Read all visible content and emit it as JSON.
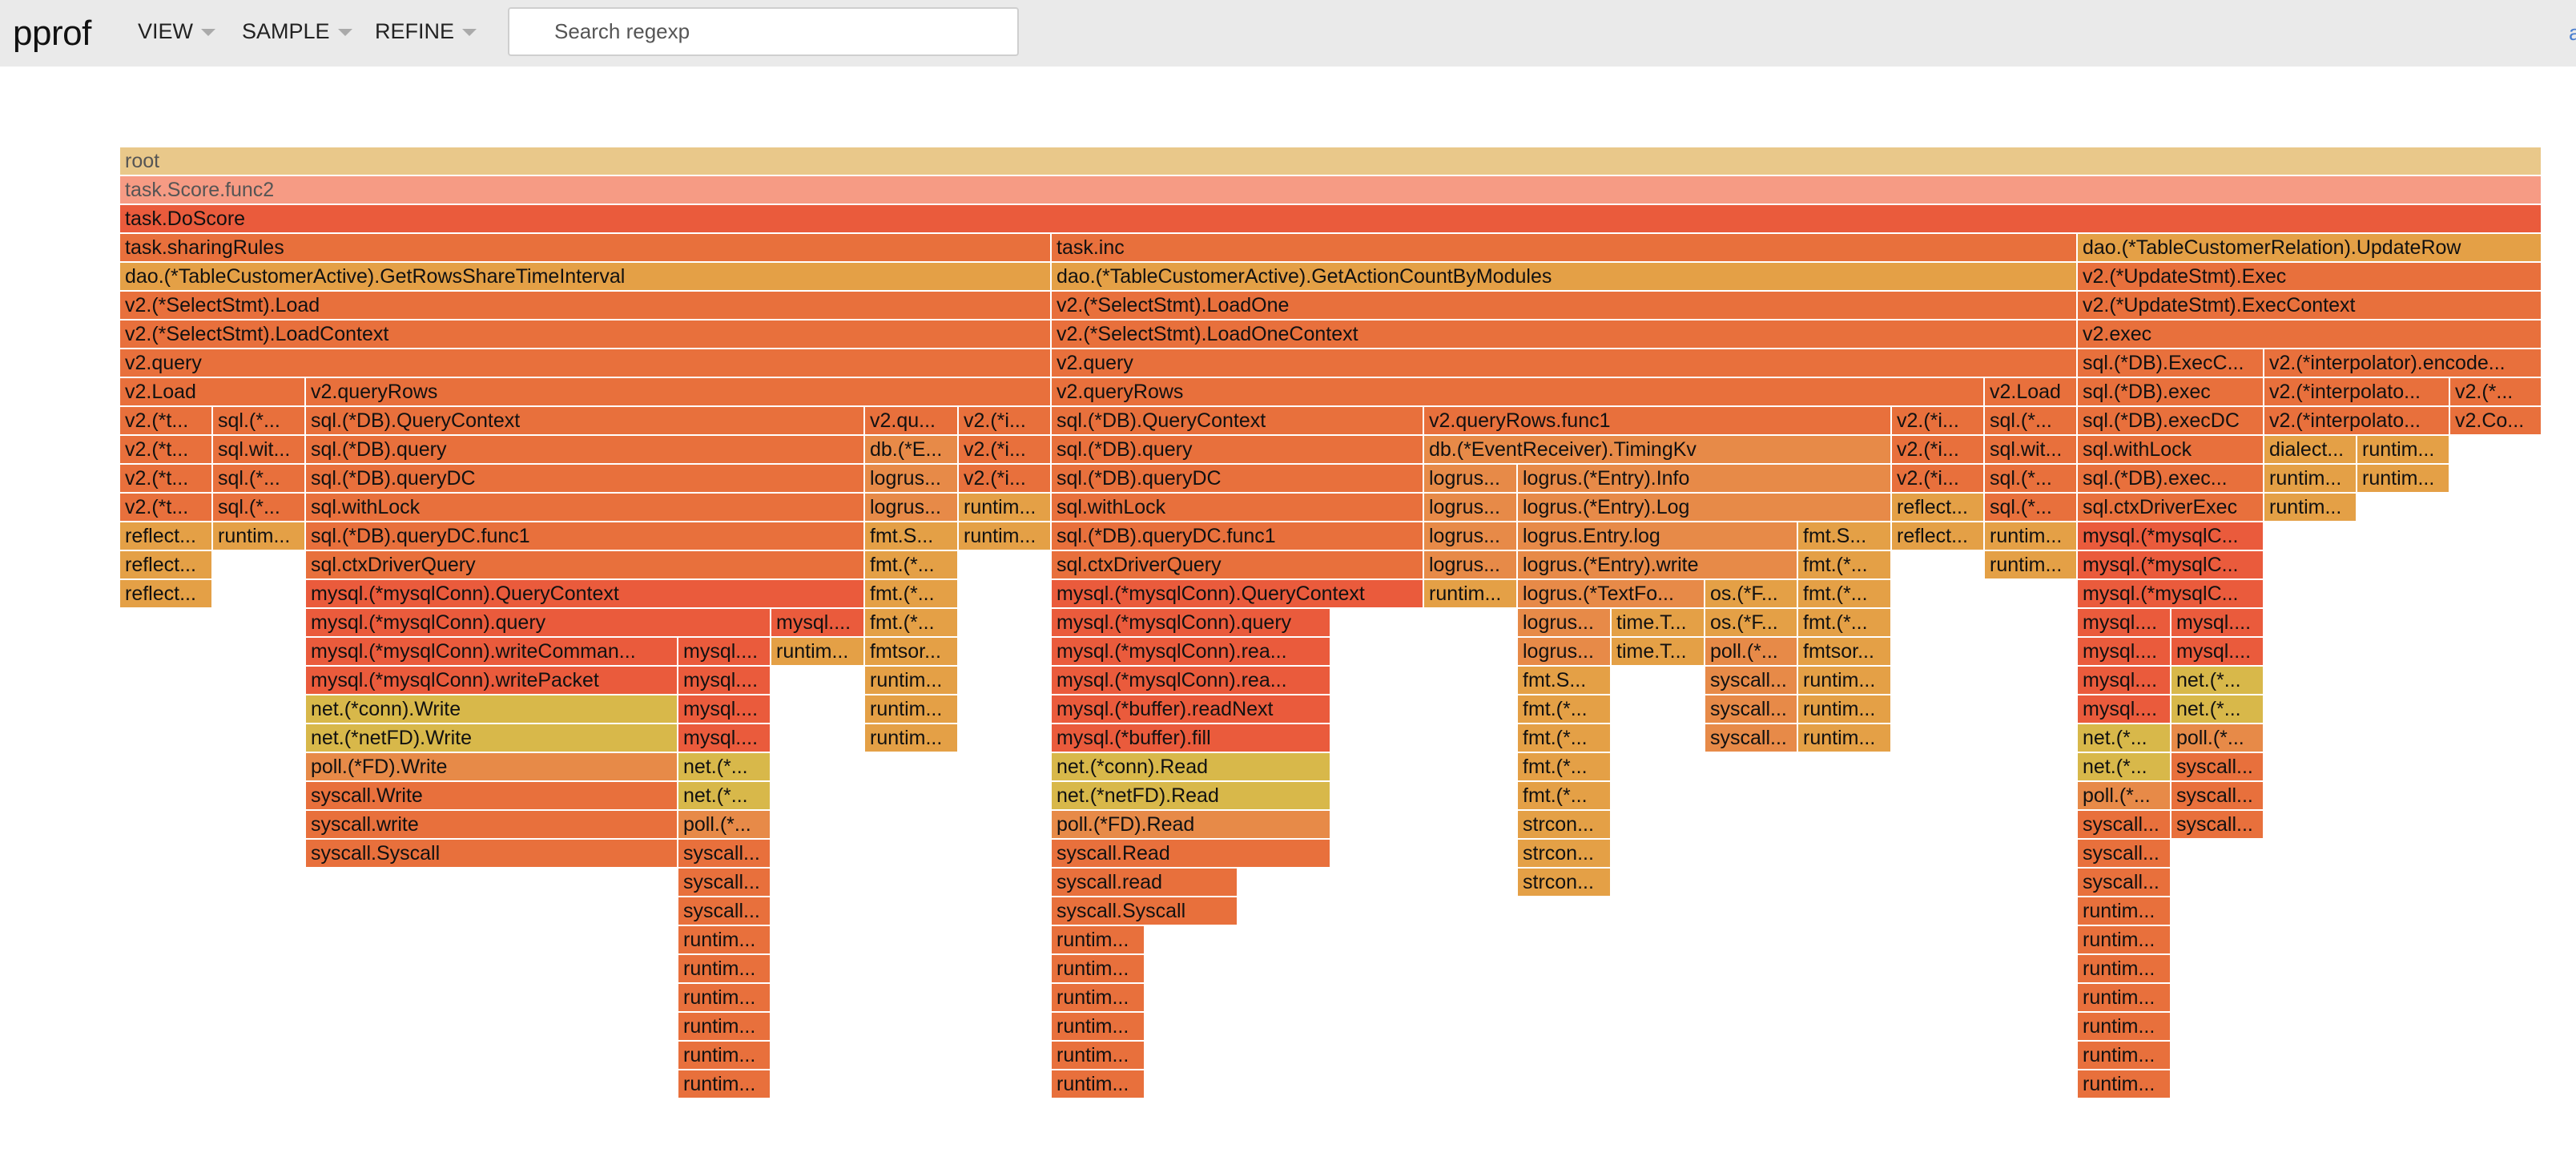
{
  "app": {
    "logo": "pprof",
    "menus": [
      {
        "label": "VIEW"
      },
      {
        "label": "SAMPLE"
      },
      {
        "label": "REFINE"
      }
    ],
    "search_placeholder": "Search regexp",
    "corner_link": "a"
  },
  "colors": {
    "root": "#e9c88a",
    "pink": "#f69b84",
    "red": "#ea5b3c",
    "orange": "#e8703c",
    "amber": "#e4a046",
    "yellow": "#d8b84a",
    "coral": "#e78a48"
  },
  "frames": [
    [
      "root",
      "root"
    ],
    [
      "task.Score.func2",
      "pink"
    ],
    [
      "task.DoScore",
      "red"
    ],
    [
      "task.sharingRules",
      "orange"
    ],
    [
      "task.inc",
      "orange"
    ],
    [
      "dao.(*TableCustomerRelation).UpdateRow",
      "amber"
    ],
    [
      "dao.(*TableCustomerActive).GetRowsShareTimeInterval",
      "amber"
    ],
    [
      "dao.(*TableCustomerActive).GetActionCountByModules",
      "amber"
    ],
    [
      "v2.(*UpdateStmt).Exec",
      "orange"
    ],
    [
      "v2.(*SelectStmt).Load",
      "orange"
    ],
    [
      "v2.(*SelectStmt).LoadOne",
      "orange"
    ],
    [
      "v2.(*UpdateStmt).ExecContext",
      "orange"
    ],
    [
      "v2.(*SelectStmt).LoadContext",
      "orange"
    ],
    [
      "v2.(*SelectStmt).LoadOneContext",
      "orange"
    ],
    [
      "v2.exec",
      "orange"
    ],
    [
      "v2.query",
      "orange"
    ],
    [
      "v2.query",
      "orange"
    ],
    [
      "sql.(*DB).ExecC...",
      "orange"
    ],
    [
      "v2.(*interpolator).encode...",
      "orange"
    ],
    [
      "v2.Load",
      "orange"
    ],
    [
      "v2.queryRows",
      "orange"
    ],
    [
      "v2.queryRows",
      "orange"
    ],
    [
      "v2.Load",
      "orange"
    ],
    [
      "sql.(*DB).exec",
      "orange"
    ],
    [
      "v2.(*interpolato...",
      "orange"
    ],
    [
      "v2.(*...",
      "orange"
    ],
    [
      "v2.(*t...",
      "orange"
    ],
    [
      "sql.(*...",
      "orange"
    ],
    [
      "sql.(*DB).QueryContext",
      "orange"
    ],
    [
      "v2.qu...",
      "orange"
    ],
    [
      "v2.(*i...",
      "orange"
    ],
    [
      "sql.(*DB).QueryContext",
      "orange"
    ],
    [
      "v2.queryRows.func1",
      "orange"
    ],
    [
      "v2.(*i...",
      "orange"
    ],
    [
      "sql.(*...",
      "orange"
    ],
    [
      "sql.(*DB).execDC",
      "orange"
    ],
    [
      "v2.(*interpolato...",
      "orange"
    ],
    [
      "v2.Co...",
      "orange"
    ],
    [
      "v2.(*t...",
      "orange"
    ],
    [
      "sql.wit...",
      "orange"
    ],
    [
      "sql.(*DB).query",
      "orange"
    ],
    [
      "db.(*E...",
      "coral"
    ],
    [
      "v2.(*i...",
      "orange"
    ],
    [
      "sql.(*DB).query",
      "orange"
    ],
    [
      "db.(*EventReceiver).TimingKv",
      "coral"
    ],
    [
      "v2.(*i...",
      "orange"
    ],
    [
      "sql.wit...",
      "orange"
    ],
    [
      "sql.withLock",
      "orange"
    ],
    [
      "dialect...",
      "amber"
    ],
    [
      "runtim...",
      "amber"
    ],
    [
      "v2.(*t...",
      "orange"
    ],
    [
      "sql.(*...",
      "orange"
    ],
    [
      "sql.(*DB).queryDC",
      "orange"
    ],
    [
      "logrus...",
      "coral"
    ],
    [
      "v2.(*i...",
      "orange"
    ],
    [
      "sql.(*DB).queryDC",
      "orange"
    ],
    [
      "logrus...",
      "coral"
    ],
    [
      "logrus.(*Entry).Info",
      "coral"
    ],
    [
      "v2.(*i...",
      "orange"
    ],
    [
      "sql.(*...",
      "orange"
    ],
    [
      "sql.(*DB).exec...",
      "orange"
    ],
    [
      "runtim...",
      "amber"
    ],
    [
      "runtim...",
      "amber"
    ],
    [
      "v2.(*t...",
      "orange"
    ],
    [
      "sql.(*...",
      "orange"
    ],
    [
      "sql.withLock",
      "orange"
    ],
    [
      "logrus...",
      "coral"
    ],
    [
      "runtim...",
      "amber"
    ],
    [
      "sql.withLock",
      "orange"
    ],
    [
      "logrus...",
      "coral"
    ],
    [
      "logrus.(*Entry).Log",
      "coral"
    ],
    [
      "reflect...",
      "amber"
    ],
    [
      "sql.(*...",
      "orange"
    ],
    [
      "sql.ctxDriverExec",
      "orange"
    ],
    [
      "runtim...",
      "amber"
    ],
    [
      "reflect...",
      "amber"
    ],
    [
      "runtim...",
      "amber"
    ],
    [
      "sql.(*DB).queryDC.func1",
      "orange"
    ],
    [
      "fmt.S...",
      "amber"
    ],
    [
      "runtim...",
      "amber"
    ],
    [
      "sql.(*DB).queryDC.func1",
      "orange"
    ],
    [
      "logrus...",
      "coral"
    ],
    [
      "logrus.Entry.log",
      "coral"
    ],
    [
      "fmt.S...",
      "amber"
    ],
    [
      "reflect...",
      "amber"
    ],
    [
      "runtim...",
      "amber"
    ],
    [
      "mysql.(*mysqlC...",
      "red"
    ],
    [
      "reflect...",
      "amber"
    ],
    [
      "sql.ctxDriverQuery",
      "orange"
    ],
    [
      "fmt.(*...",
      "amber"
    ],
    [
      "sql.ctxDriverQuery",
      "orange"
    ],
    [
      "logrus...",
      "coral"
    ],
    [
      "logrus.(*Entry).write",
      "coral"
    ],
    [
      "fmt.(*...",
      "amber"
    ],
    [
      "runtim...",
      "amber"
    ],
    [
      "mysql.(*mysqlC...",
      "red"
    ],
    [
      "reflect...",
      "amber"
    ],
    [
      "mysql.(*mysqlConn).QueryContext",
      "red"
    ],
    [
      "fmt.(*...",
      "amber"
    ],
    [
      "mysql.(*mysqlConn).QueryContext",
      "red"
    ],
    [
      "runtim...",
      "amber"
    ],
    [
      "logrus.(*TextFo...",
      "coral"
    ],
    [
      "os.(*F...",
      "amber"
    ],
    [
      "fmt.(*...",
      "amber"
    ],
    [
      "mysql.(*mysqlC...",
      "red"
    ],
    [
      "mysql.(*mysqlConn).query",
      "red"
    ],
    [
      "mysql....",
      "red"
    ],
    [
      "fmt.(*...",
      "amber"
    ],
    [
      "mysql.(*mysqlConn).query",
      "red"
    ],
    [
      "logrus...",
      "coral"
    ],
    [
      "time.T...",
      "amber"
    ],
    [
      "os.(*F...",
      "amber"
    ],
    [
      "fmt.(*...",
      "amber"
    ],
    [
      "mysql....",
      "red"
    ],
    [
      "mysql....",
      "red"
    ],
    [
      "mysql.(*mysqlConn).writeComman...",
      "red"
    ],
    [
      "mysql....",
      "red"
    ],
    [
      "runtim...",
      "amber"
    ],
    [
      "fmtsor...",
      "amber"
    ],
    [
      "mysql.(*mysqlConn).rea...",
      "red"
    ],
    [
      "logrus...",
      "coral"
    ],
    [
      "time.T...",
      "amber"
    ],
    [
      "poll.(*...",
      "coral"
    ],
    [
      "fmtsor...",
      "amber"
    ],
    [
      "mysql....",
      "red"
    ],
    [
      "mysql....",
      "red"
    ],
    [
      "mysql.(*mysqlConn).writePacket",
      "red"
    ],
    [
      "mysql....",
      "red"
    ],
    [
      "runtim...",
      "amber"
    ],
    [
      "mysql.(*mysqlConn).rea...",
      "red"
    ],
    [
      "fmt.S...",
      "amber"
    ],
    [
      "syscall...",
      "coral"
    ],
    [
      "runtim...",
      "amber"
    ],
    [
      "mysql....",
      "red"
    ],
    [
      "net.(*...",
      "yellow"
    ],
    [
      "net.(*conn).Write",
      "yellow"
    ],
    [
      "mysql....",
      "red"
    ],
    [
      "runtim...",
      "amber"
    ],
    [
      "mysql.(*buffer).readNext",
      "red"
    ],
    [
      "fmt.(*...",
      "amber"
    ],
    [
      "syscall...",
      "coral"
    ],
    [
      "runtim...",
      "amber"
    ],
    [
      "mysql....",
      "red"
    ],
    [
      "net.(*...",
      "yellow"
    ],
    [
      "net.(*netFD).Write",
      "yellow"
    ],
    [
      "mysql....",
      "red"
    ],
    [
      "runtim...",
      "amber"
    ],
    [
      "mysql.(*buffer).fill",
      "red"
    ],
    [
      "fmt.(*...",
      "amber"
    ],
    [
      "syscall...",
      "coral"
    ],
    [
      "runtim...",
      "amber"
    ],
    [
      "net.(*...",
      "yellow"
    ],
    [
      "poll.(*...",
      "coral"
    ],
    [
      "poll.(*FD).Write",
      "coral"
    ],
    [
      "net.(*...",
      "yellow"
    ],
    [
      "net.(*conn).Read",
      "yellow"
    ],
    [
      "fmt.(*...",
      "amber"
    ],
    [
      "net.(*...",
      "yellow"
    ],
    [
      "syscall...",
      "orange"
    ],
    [
      "syscall.Write",
      "orange"
    ],
    [
      "net.(*...",
      "yellow"
    ],
    [
      "net.(*netFD).Read",
      "yellow"
    ],
    [
      "fmt.(*...",
      "amber"
    ],
    [
      "poll.(*...",
      "coral"
    ],
    [
      "syscall...",
      "orange"
    ],
    [
      "syscall.write",
      "orange"
    ],
    [
      "poll.(*...",
      "coral"
    ],
    [
      "poll.(*FD).Read",
      "coral"
    ],
    [
      "strcon...",
      "amber"
    ],
    [
      "syscall...",
      "orange"
    ],
    [
      "syscall...",
      "orange"
    ],
    [
      "syscall.Syscall",
      "orange"
    ],
    [
      "syscall...",
      "orange"
    ],
    [
      "syscall.Read",
      "orange"
    ],
    [
      "strcon...",
      "amber"
    ],
    [
      "syscall...",
      "orange"
    ],
    [
      "syscall...",
      "orange"
    ],
    [
      "syscall.read",
      "orange"
    ],
    [
      "strcon...",
      "amber"
    ],
    [
      "syscall...",
      "orange"
    ],
    [
      "syscall...",
      "orange"
    ],
    [
      "syscall.Syscall",
      "orange"
    ],
    [
      "runtim...",
      "orange"
    ],
    [
      "runtim...",
      "orange"
    ],
    [
      "runtim...",
      "orange"
    ],
    [
      "runtim...",
      "orange"
    ],
    [
      "runtim...",
      "orange"
    ],
    [
      "runtim...",
      "orange"
    ],
    [
      "runtim...",
      "orange"
    ],
    [
      "runtim...",
      "orange"
    ],
    [
      "runtim...",
      "orange"
    ],
    [
      "runtim...",
      "orange"
    ],
    [
      "runtim...",
      "orange"
    ],
    [
      "runtim...",
      "orange"
    ],
    [
      "runtim...",
      "orange"
    ],
    [
      "runtim...",
      "orange"
    ],
    [
      "runtim...",
      "orange"
    ],
    [
      "runtim...",
      "orange"
    ],
    [
      "runtim...",
      "orange"
    ],
    [
      "runtim...",
      "orange"
    ],
    [
      "runtim...",
      "orange"
    ]
  ]
}
